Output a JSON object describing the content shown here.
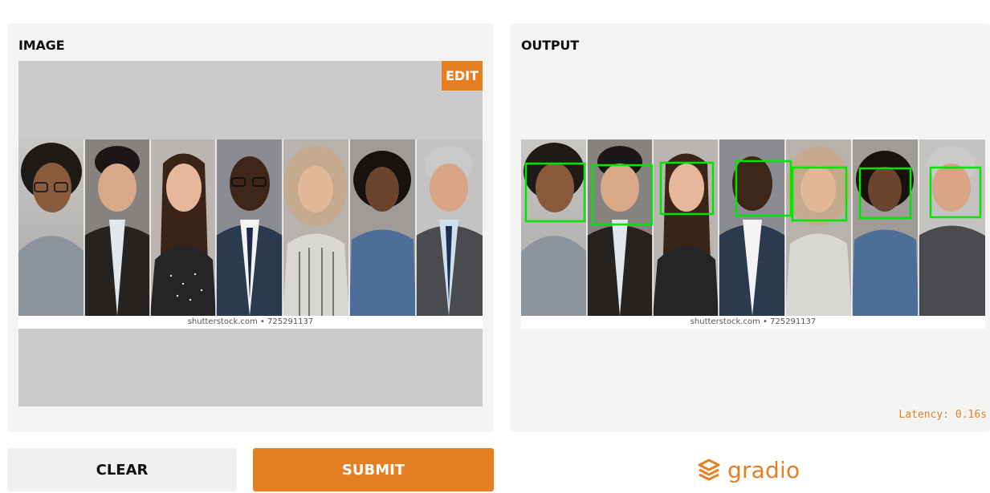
{
  "input_panel": {
    "title": "IMAGE",
    "edit_label": "EDIT",
    "caption": "shutterstock.com • 725291137"
  },
  "output_panel": {
    "title": "OUTPUT",
    "caption": "shutterstock.com • 725291137",
    "latency": "Latency: 0.16s",
    "detections_count": 7
  },
  "buttons": {
    "clear_label": "CLEAR",
    "submit_label": "SUBMIT"
  },
  "branding": {
    "name": "gradio",
    "icon": "gradio-logo-icon"
  },
  "colors": {
    "accent": "#e67e22",
    "panel_bg": "#f4f4f4",
    "box": "#00e600"
  }
}
